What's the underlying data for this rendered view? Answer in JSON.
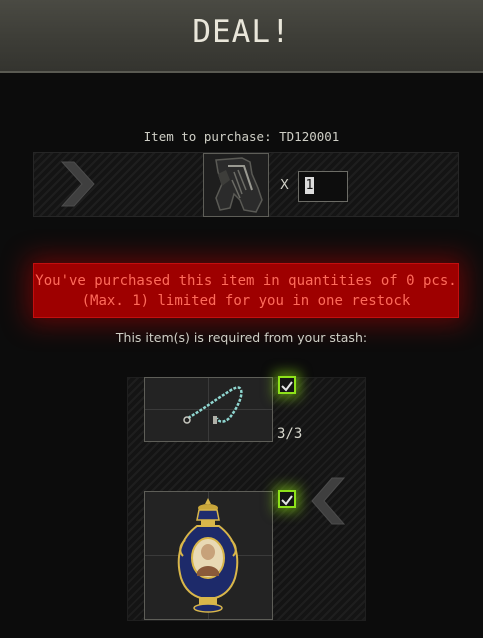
{
  "header": {
    "title": "DEAL!"
  },
  "purchase": {
    "label": "Item to purchase: TD120001",
    "item_icon": "grip-icon",
    "multiply_symbol": "X",
    "quantity_value": "1"
  },
  "warning": {
    "text_line1": "You've purchased this item in quantities of 0 pcs.",
    "text_line2": "(Max. 1) limited for you in one restock"
  },
  "requirements": {
    "label": "This item(s) is required from your stash:",
    "items": [
      {
        "icon": "chain-icon",
        "count": "3/3",
        "checked": true
      },
      {
        "icon": "vase-icon",
        "count": "",
        "checked": true
      }
    ]
  },
  "colors": {
    "warning_bg": "#9e0000",
    "warning_text": "#ff6b5b",
    "check_green": "#8ee21a"
  }
}
